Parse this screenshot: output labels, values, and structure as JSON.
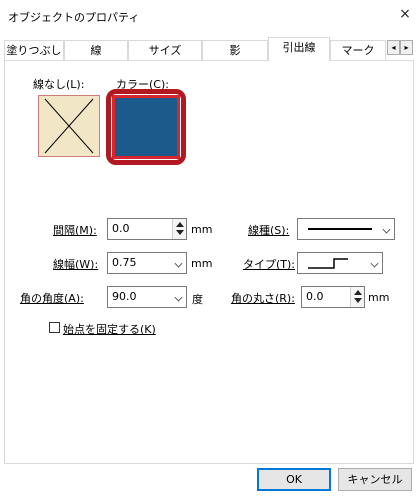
{
  "window": {
    "title": "オブジェクトのプロパティ",
    "close_glyph": "×"
  },
  "tabs": [
    {
      "label": "塗りつぶし"
    },
    {
      "label": "線"
    },
    {
      "label": "サイズ"
    },
    {
      "label": "影"
    },
    {
      "label": "引出線",
      "active": true
    },
    {
      "label": "マーク"
    }
  ],
  "tab_scroll": {
    "left": "◂",
    "right": "▸"
  },
  "swatches": {
    "no_line_label": "線なし(L):",
    "color_label": "カラー(C):",
    "selected_color": "#1d5a8c",
    "highlight_color": "#b1181f"
  },
  "fields": {
    "spacing": {
      "label": "間隔(M):",
      "value": "0.0",
      "unit": "mm"
    },
    "width": {
      "label": "線幅(W):",
      "value": "0.75",
      "unit": "mm"
    },
    "angle": {
      "label": "角の角度(A):",
      "value": "90.0",
      "unit": "度"
    },
    "line_style": {
      "label": "線種(S):"
    },
    "type": {
      "label": "タイプ(T):"
    },
    "rounding": {
      "label": "角の丸さ(R):",
      "value": "0.0",
      "unit": "mm"
    }
  },
  "checkbox": {
    "label": "始点を固定する(K)",
    "checked": false
  },
  "buttons": {
    "ok": "OK",
    "cancel": "キャンセル"
  }
}
